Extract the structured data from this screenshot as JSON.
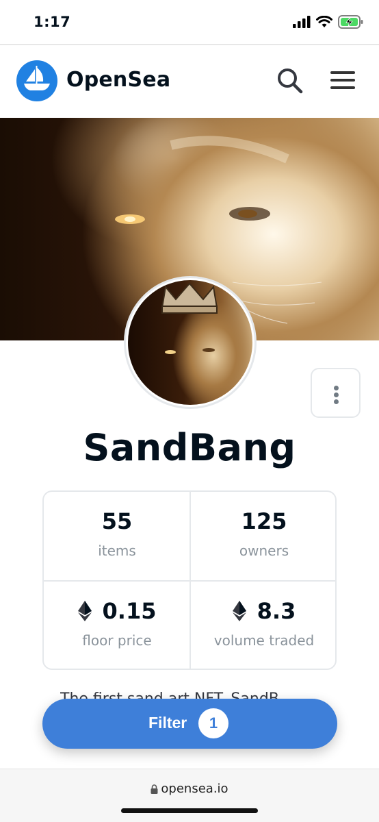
{
  "status_bar": {
    "time": "1:17",
    "signal_icon": "signal-bars-icon",
    "wifi_icon": "wifi-icon",
    "battery_icon": "battery-charging-icon"
  },
  "header": {
    "brand": "OpenSea",
    "logo_icon": "opensea-boat-icon",
    "search_icon": "search-icon",
    "menu_icon": "hamburger-menu-icon"
  },
  "collection": {
    "name": "SandBang",
    "more_icon": "vertical-dots-icon",
    "description_peek": "The first sand art NFT. SandB"
  },
  "stats": [
    {
      "value": "55",
      "label": "items"
    },
    {
      "value": "125",
      "label": "owners"
    },
    {
      "value": "0.15",
      "label": "floor price",
      "icon": "ethereum-icon"
    },
    {
      "value": "8.3",
      "label": "volume traded",
      "icon": "ethereum-icon"
    }
  ],
  "filter": {
    "label": "Filter",
    "count": "1"
  },
  "browser": {
    "url": "opensea.io",
    "lock_icon": "lock-icon"
  },
  "colors": {
    "brand_blue": "#2081e2",
    "filter_blue": "#3e7fd9",
    "text_dark": "#04111d",
    "text_muted": "#8a939b",
    "border": "#e5e8eb"
  }
}
